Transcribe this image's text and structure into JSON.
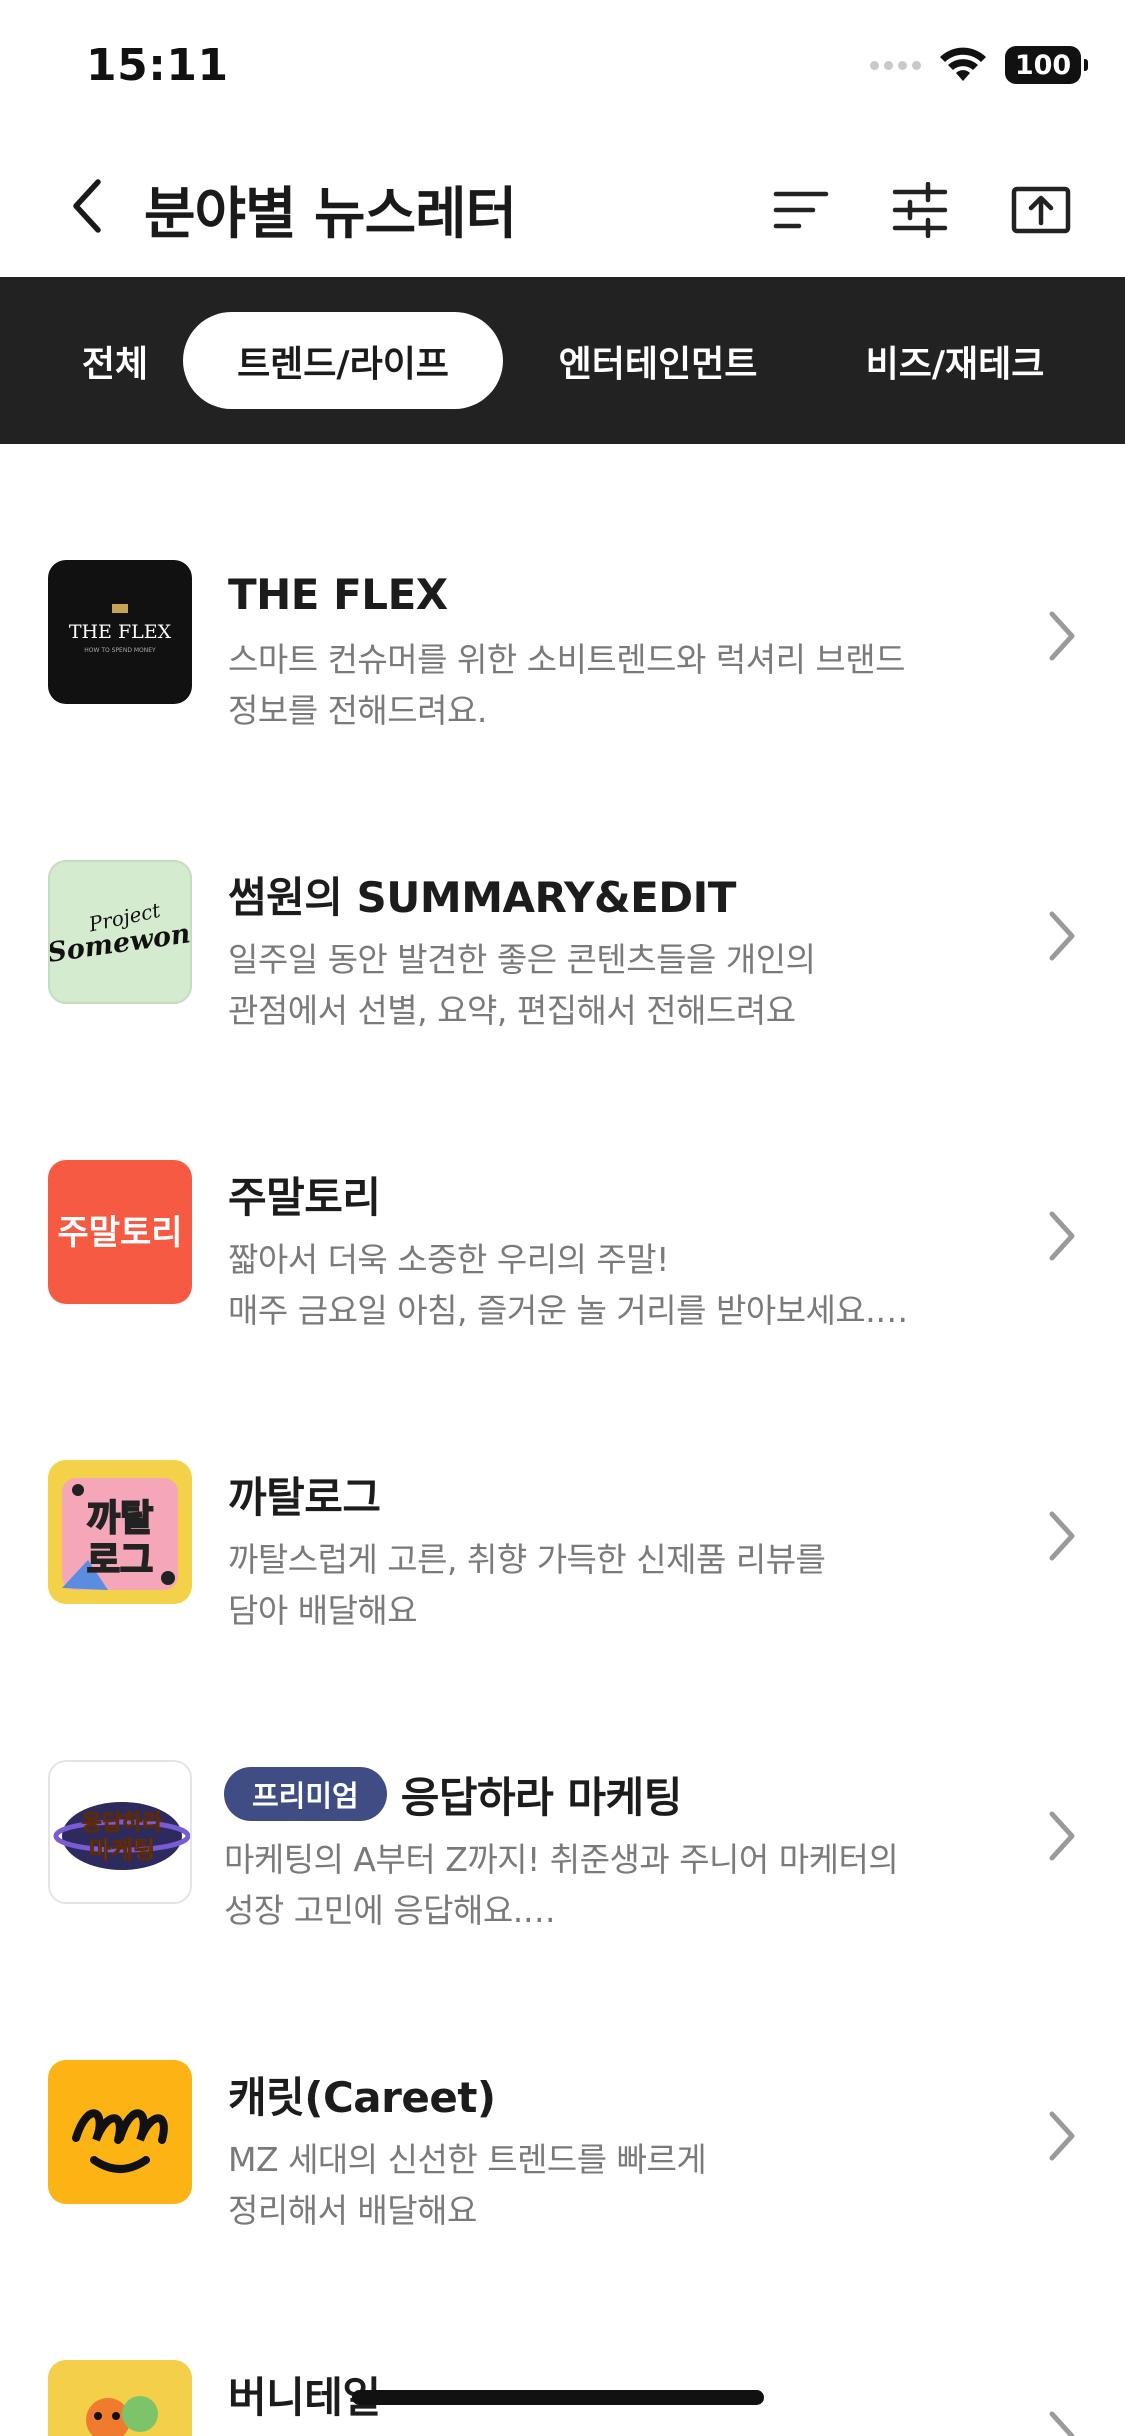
{
  "status_bar": {
    "time": "15:11",
    "battery": "100"
  },
  "header": {
    "title": "분야별 뉴스레터"
  },
  "tabs": [
    {
      "label": "전체",
      "active": false
    },
    {
      "label": "트렌드/라이프",
      "active": true
    },
    {
      "label": "엔터테인먼트",
      "active": false
    },
    {
      "label": "비즈/재테크",
      "active": false
    }
  ],
  "newsletters": [
    {
      "title": "THE FLEX",
      "desc_line1": "스마트 컨슈머를 위한 소비트렌드와 럭셔리 브랜드",
      "desc_line2": "정보를 전해드려요.",
      "thumb_text": "THE FLEX",
      "thumb_subtext": "HOW TO SPEND MONEY",
      "color": "#111111"
    },
    {
      "title": "썸원의 SUMMARY&EDIT",
      "desc_line1": "일주일 동안 발견한 좋은 콘텐츠들을 개인의",
      "desc_line2": "관점에서 선별, 요약, 편집해서 전해드려요",
      "thumb_text": "Somewon",
      "thumb_subtext": "Project",
      "color": "#d5ebcf"
    },
    {
      "title": "주말토리",
      "desc_line1": "짧아서 더욱 소중한 우리의 주말!",
      "desc_line2": "매주 금요일 아침, 즐거운 놀 거리를 받아보세요.…",
      "thumb_text": "주말토리",
      "color": "#f65a43"
    },
    {
      "title": "까탈로그",
      "desc_line1": "까탈스럽게 고른, 취향 가득한 신제품 리뷰를",
      "desc_line2": "담아 배달해요",
      "thumb_text": "까탈\n로그",
      "color": "#f3d24a"
    },
    {
      "badge": "프리미엄",
      "title": "응답하라 마케팅",
      "desc_line1": "마케팅의 A부터 Z까지! 취준생과 주니어 마케터의",
      "desc_line2": "성장 고민에 응답해요.…",
      "thumb_text": "응답하라\n마케팅",
      "color": "#ffffff"
    },
    {
      "title": "캐릿(Careet)",
      "desc_line1": "MZ 세대의 신선한 트렌드를 빠르게",
      "desc_line2": "정리해서 배달해요",
      "color": "#fbb413"
    },
    {
      "title": "버니테일",
      "color": "#f4cf4a"
    }
  ]
}
